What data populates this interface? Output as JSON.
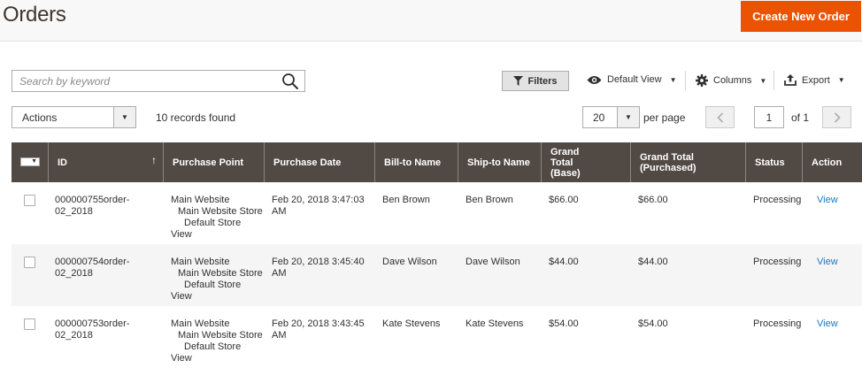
{
  "page": {
    "title": "Orders",
    "create_button": "Create New Order"
  },
  "toolbar": {
    "search_placeholder": "Search by keyword",
    "filters_label": "Filters",
    "view_label": "Default View",
    "columns_label": "Columns",
    "export_label": "Export",
    "actions_label": "Actions",
    "records_found": "10 records found",
    "page_size": "20",
    "per_page_label": "per page",
    "current_page": "1",
    "of_total": "of 1"
  },
  "grid": {
    "columns": [
      "ID",
      "Purchase Point",
      "Purchase Date",
      "Bill-to Name",
      "Ship-to Name",
      "Grand Total (Base)",
      "Grand Total (Purchased)",
      "Status",
      "Action"
    ],
    "rows": [
      {
        "id": "000000755order-02_2018",
        "purchase_point": [
          "Main Website",
          "Main Website Store",
          "Default Store",
          "View"
        ],
        "purchase_date": "Feb 20, 2018 3:47:03 AM",
        "bill_to": "Ben Brown",
        "ship_to": "Ben Brown",
        "total_base": "$66.00",
        "total_purchased": "$66.00",
        "status": "Processing",
        "action": "View"
      },
      {
        "id": "000000754order-02_2018",
        "purchase_point": [
          "Main Website",
          "Main Website Store",
          "Default Store",
          "View"
        ],
        "purchase_date": "Feb 20, 2018 3:45:40 AM",
        "bill_to": "Dave Wilson",
        "ship_to": "Dave Wilson",
        "total_base": "$44.00",
        "total_purchased": "$44.00",
        "status": "Processing",
        "action": "View"
      },
      {
        "id": "000000753order-02_2018",
        "purchase_point": [
          "Main Website",
          "Main Website Store",
          "Default Store",
          "View"
        ],
        "purchase_date": "Feb 20, 2018 3:43:45 AM",
        "bill_to": "Kate Stevens",
        "ship_to": "Kate Stevens",
        "total_base": "$54.00",
        "total_purchased": "$54.00",
        "status": "Processing",
        "action": "View"
      }
    ]
  },
  "colors": {
    "accent": "#eb5202",
    "header_bg": "#514943",
    "link": "#1979c3"
  },
  "icons": [
    "search-icon",
    "filter-icon",
    "eye-icon",
    "gear-icon",
    "export-icon",
    "chevron-down-icon",
    "chevron-left-icon",
    "chevron-right-icon",
    "sort-up-icon"
  ]
}
